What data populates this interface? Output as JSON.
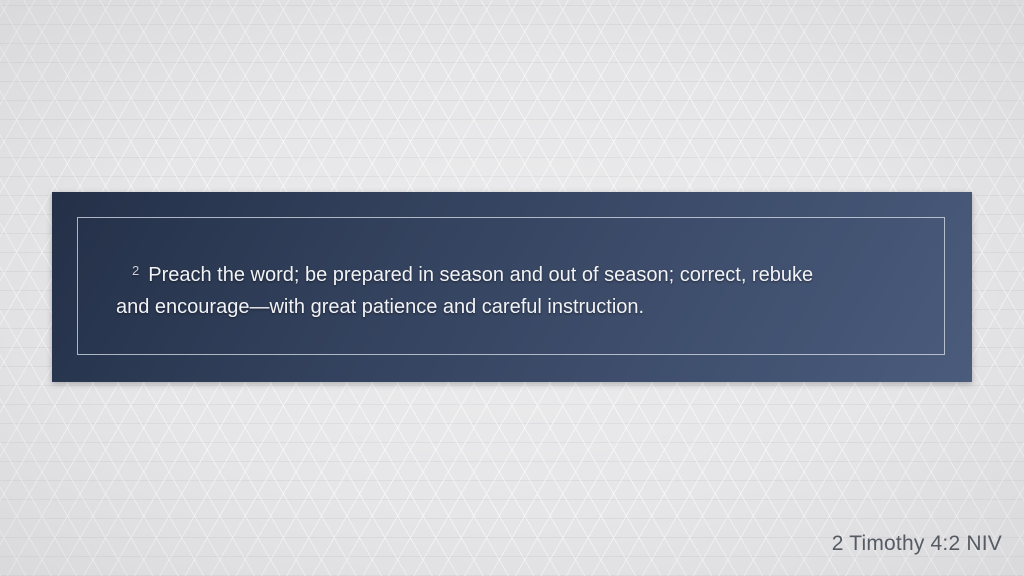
{
  "verse": {
    "number": "2",
    "line1": "Preach the word; be prepared in season and out of season; correct, rebuke",
    "line2": "and encourage—with great patience and careful instruction."
  },
  "reference": "2 Timothy 4:2 NIV",
  "colors": {
    "panel_start": "#243048",
    "panel_end": "#4a5b7c",
    "background": "#e6e6e8",
    "verse_text": "#f2f3f6",
    "reference_text": "#555a63"
  }
}
